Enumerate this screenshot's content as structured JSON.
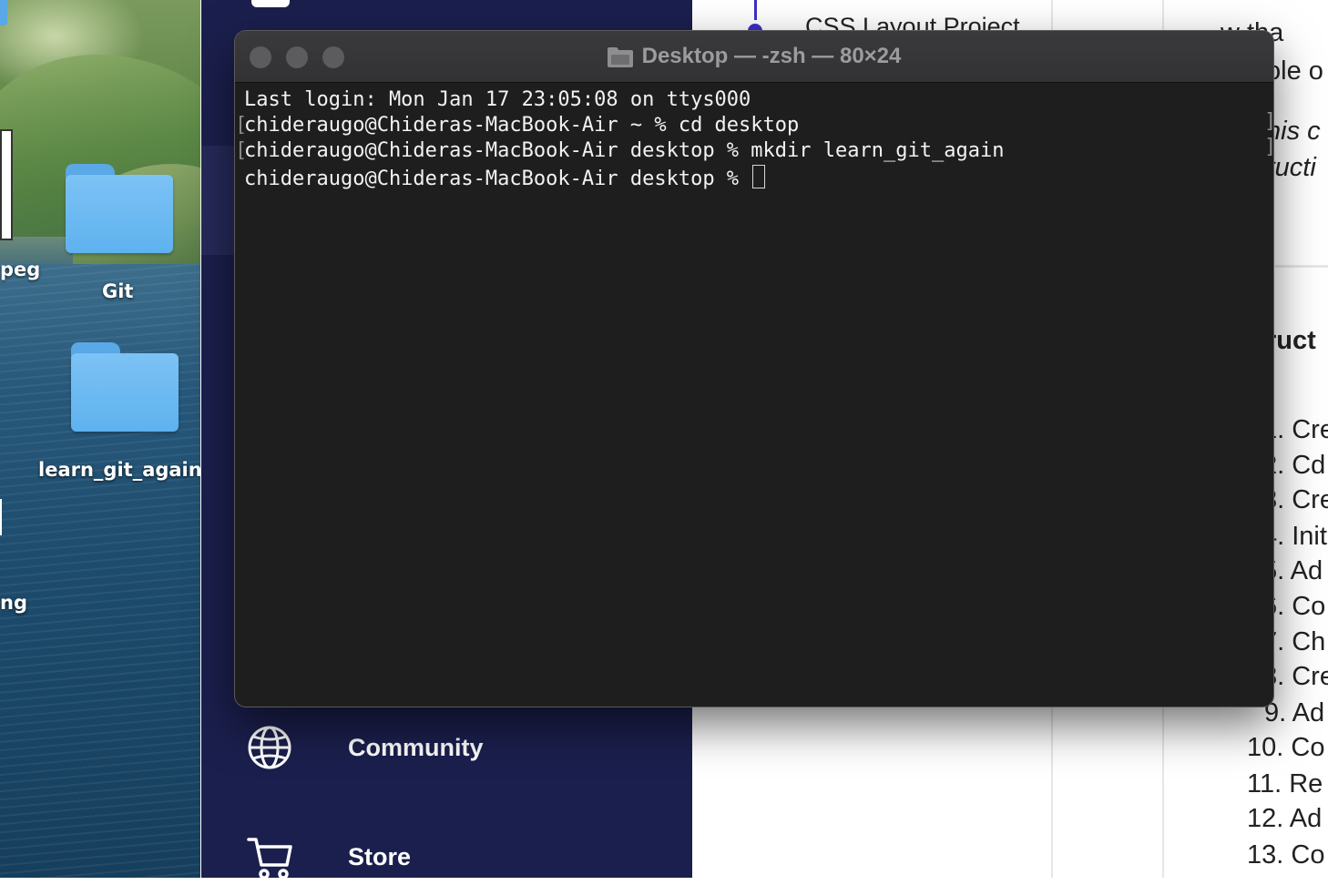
{
  "desktop": {
    "icons": [
      {
        "name": "Git"
      },
      {
        "name": "learn_git_again"
      }
    ],
    "partial_labels": [
      "peg",
      "ng"
    ]
  },
  "sidebar": {
    "items": [
      {
        "label": "Community",
        "icon": "globe-icon"
      },
      {
        "label": "Store",
        "icon": "cart-icon"
      }
    ]
  },
  "content": {
    "project_title": "CSS Layout Project",
    "right_fragments": [
      "w tha",
      "ole o",
      "his c",
      "ructi",
      "ruct"
    ],
    "list_items": [
      "1. Cre",
      "2. Cd",
      "3. Cre",
      "4. Init",
      "5. Ad",
      "6. Co",
      "7. Ch",
      "8. Cre",
      "9. Ad",
      "10. Co",
      "11. Re",
      "12. Ad",
      "13. Co"
    ]
  },
  "terminal": {
    "title": "Desktop — -zsh — 80×24",
    "lines": [
      "Last login: Mon Jan 17 23:05:08 on ttys000",
      "chideraugo@Chideras-MacBook-Air ~ % cd desktop",
      "chideraugo@Chideras-MacBook-Air desktop % mkdir learn_git_again",
      "chideraugo@Chideras-MacBook-Air desktop % "
    ]
  },
  "colors": {
    "sidebar_bg": "#1b1f4d",
    "accent": "#3b2fc8",
    "terminal_bg": "#1e1e1e",
    "folder_blue": "#5eb2ef"
  }
}
